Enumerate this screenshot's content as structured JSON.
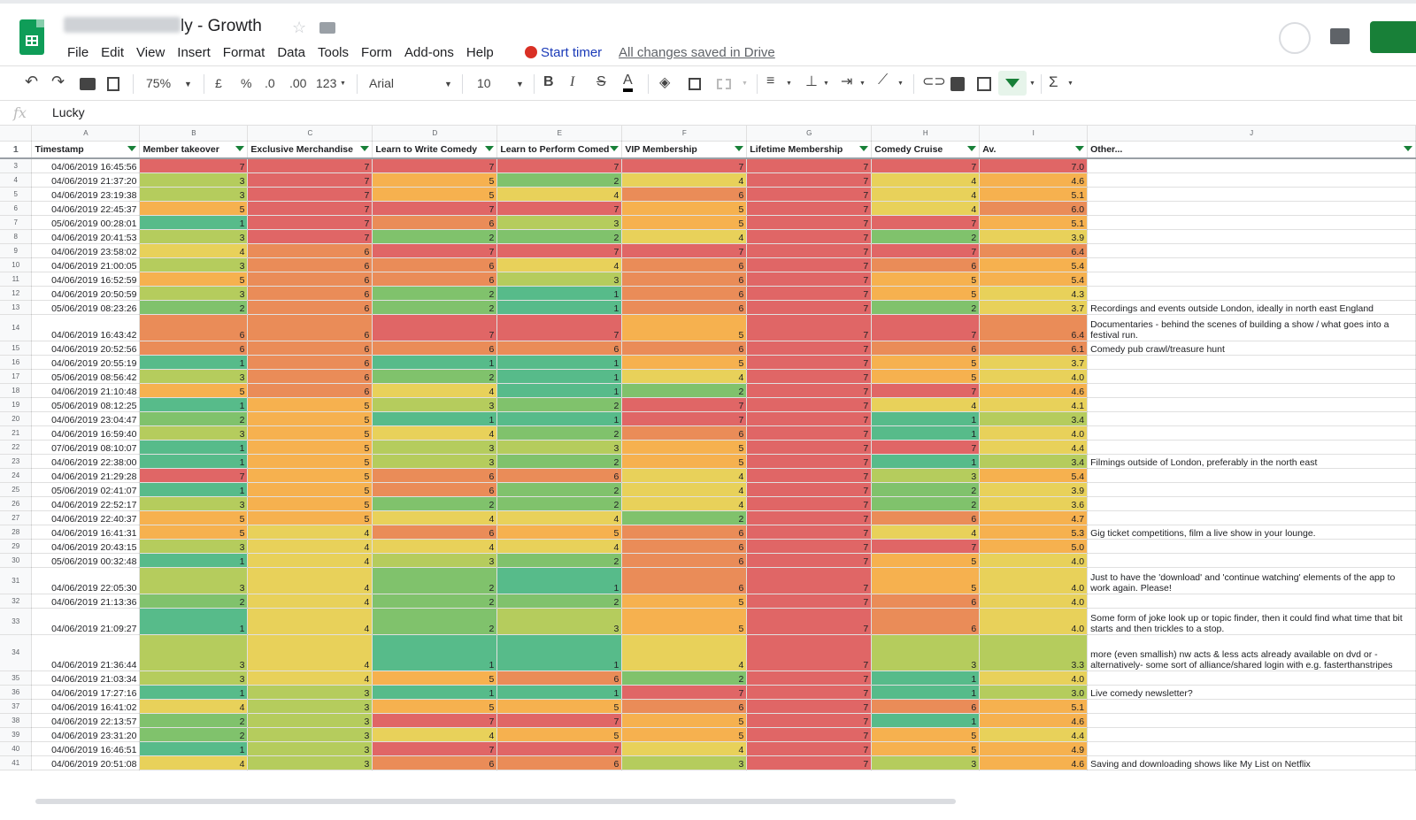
{
  "app": {
    "title_suffix": "ly - Growth",
    "menu": [
      "File",
      "Edit",
      "View",
      "Insert",
      "Format",
      "Data",
      "Tools",
      "Form",
      "Add-ons",
      "Help"
    ],
    "timer_label": "Start timer",
    "saved_label": "All changes saved in Drive"
  },
  "toolbar": {
    "zoom": "75%",
    "currency": "£",
    "percent": "%",
    "dec_decrease": ".0",
    "dec_increase": ".00",
    "format_more": "123",
    "font": "Arial",
    "font_size": "10",
    "bold": "B",
    "italic": "I",
    "strike": "S",
    "text_color": "A",
    "sum": "Σ"
  },
  "formula_bar": {
    "fx": "fx",
    "value": "Lucky"
  },
  "sheet": {
    "col_letters": [
      "A",
      "B",
      "C",
      "D",
      "E",
      "F",
      "G",
      "H",
      "I",
      "J"
    ],
    "headers": [
      "Timestamp",
      "Member takeover",
      "Exclusive Merchandise",
      "Learn to Write Comedy",
      "Learn to Perform Comed",
      "VIP Membership",
      "Lifetime Membership",
      "Comedy Cruise",
      "Av.",
      "Other..."
    ],
    "header_row_num": "1",
    "scale_colors": {
      "1": "#57bb8a",
      "2": "#80c26c",
      "3": "#b5cc5d",
      "4": "#e8d15a",
      "5": "#f6b14f",
      "6": "#ea8c58",
      "7": "#e06666"
    },
    "rows": [
      {
        "n": "3",
        "ts": "04/06/2019 16:45:56",
        "v": [
          7,
          7,
          7,
          7,
          7,
          7,
          7
        ],
        "av": "7.0",
        "other": ""
      },
      {
        "n": "4",
        "ts": "04/06/2019 21:37:20",
        "v": [
          3,
          7,
          5,
          2,
          4,
          7,
          4
        ],
        "av": "4.6",
        "other": ""
      },
      {
        "n": "5",
        "ts": "04/06/2019 23:19:38",
        "v": [
          3,
          7,
          5,
          4,
          6,
          7,
          4
        ],
        "av": "5.1",
        "other": ""
      },
      {
        "n": "6",
        "ts": "04/06/2019 22:45:37",
        "v": [
          5,
          7,
          7,
          7,
          5,
          7,
          4
        ],
        "av": "6.0",
        "other": ""
      },
      {
        "n": "7",
        "ts": "05/06/2019 00:28:01",
        "v": [
          1,
          7,
          6,
          3,
          5,
          7,
          7
        ],
        "av": "5.1",
        "other": ""
      },
      {
        "n": "8",
        "ts": "04/06/2019 20:41:53",
        "v": [
          3,
          7,
          2,
          2,
          4,
          7,
          2
        ],
        "av": "3.9",
        "other": ""
      },
      {
        "n": "9",
        "ts": "04/06/2019 23:58:02",
        "v": [
          4,
          6,
          7,
          7,
          7,
          7,
          7
        ],
        "av": "6.4",
        "other": ""
      },
      {
        "n": "10",
        "ts": "04/06/2019 21:00:05",
        "v": [
          3,
          6,
          6,
          4,
          6,
          7,
          6
        ],
        "av": "5.4",
        "other": ""
      },
      {
        "n": "11",
        "ts": "04/06/2019 16:52:59",
        "v": [
          5,
          6,
          6,
          3,
          6,
          7,
          5
        ],
        "av": "5.4",
        "other": ""
      },
      {
        "n": "12",
        "ts": "04/06/2019 20:50:59",
        "v": [
          3,
          6,
          2,
          1,
          6,
          7,
          5
        ],
        "av": "4.3",
        "other": ""
      },
      {
        "n": "13",
        "ts": "05/06/2019 08:23:26",
        "v": [
          2,
          6,
          2,
          1,
          6,
          7,
          2
        ],
        "av": "3.7",
        "other": "Recordings and events outside London, ideally in north east England"
      },
      {
        "n": "14",
        "ts": "04/06/2019 16:43:42",
        "v": [
          6,
          6,
          7,
          7,
          5,
          7,
          7
        ],
        "av": "6.4",
        "other": "Documentaries - behind the scenes of building a show / what goes into a festival run.",
        "tall": 2
      },
      {
        "n": "15",
        "ts": "04/06/2019 20:52:56",
        "v": [
          6,
          6,
          6,
          6,
          6,
          7,
          6
        ],
        "av": "6.1",
        "other": "Comedy pub crawl/treasure hunt"
      },
      {
        "n": "16",
        "ts": "04/06/2019 20:55:19",
        "v": [
          1,
          6,
          1,
          1,
          5,
          7,
          5
        ],
        "av": "3.7",
        "other": ""
      },
      {
        "n": "17",
        "ts": "05/06/2019 08:56:42",
        "v": [
          3,
          6,
          2,
          1,
          4,
          7,
          5
        ],
        "av": "4.0",
        "other": ""
      },
      {
        "n": "18",
        "ts": "04/06/2019 21:10:48",
        "v": [
          5,
          6,
          4,
          1,
          2,
          7,
          7
        ],
        "av": "4.6",
        "other": ""
      },
      {
        "n": "19",
        "ts": "05/06/2019 08:12:25",
        "v": [
          1,
          5,
          3,
          2,
          7,
          7,
          4
        ],
        "av": "4.1",
        "other": ""
      },
      {
        "n": "20",
        "ts": "04/06/2019 23:04:47",
        "v": [
          2,
          5,
          1,
          1,
          7,
          7,
          1
        ],
        "av": "3.4",
        "other": ""
      },
      {
        "n": "21",
        "ts": "04/06/2019 16:59:40",
        "v": [
          3,
          5,
          4,
          2,
          6,
          7,
          1
        ],
        "av": "4.0",
        "other": ""
      },
      {
        "n": "22",
        "ts": "07/06/2019 08:10:07",
        "v": [
          1,
          5,
          3,
          3,
          5,
          7,
          7
        ],
        "av": "4.4",
        "other": ""
      },
      {
        "n": "23",
        "ts": "04/06/2019 22:38:00",
        "v": [
          1,
          5,
          3,
          2,
          5,
          7,
          1
        ],
        "av": "3.4",
        "other": "Filmings outside of London, preferably in the north east"
      },
      {
        "n": "24",
        "ts": "04/06/2019 21:29:28",
        "v": [
          7,
          5,
          6,
          6,
          4,
          7,
          3
        ],
        "av": "5.4",
        "other": ""
      },
      {
        "n": "25",
        "ts": "05/06/2019 02:41:07",
        "v": [
          1,
          5,
          6,
          2,
          4,
          7,
          2
        ],
        "av": "3.9",
        "other": ""
      },
      {
        "n": "26",
        "ts": "04/06/2019 22:52:17",
        "v": [
          3,
          5,
          2,
          2,
          4,
          7,
          2
        ],
        "av": "3.6",
        "other": ""
      },
      {
        "n": "27",
        "ts": "04/06/2019 22:40:37",
        "v": [
          5,
          5,
          4,
          4,
          2,
          7,
          6
        ],
        "av": "4.7",
        "other": ""
      },
      {
        "n": "28",
        "ts": "04/06/2019 16:41:31",
        "v": [
          5,
          4,
          6,
          5,
          6,
          7,
          4
        ],
        "av": "5.3",
        "other": "Gig ticket competitions, film a live show in your lounge."
      },
      {
        "n": "29",
        "ts": "04/06/2019 20:43:15",
        "v": [
          3,
          4,
          4,
          4,
          6,
          7,
          7
        ],
        "av": "5.0",
        "other": ""
      },
      {
        "n": "30",
        "ts": "05/06/2019 00:32:48",
        "v": [
          1,
          4,
          3,
          2,
          6,
          7,
          5
        ],
        "av": "4.0",
        "other": ""
      },
      {
        "n": "31",
        "ts": "04/06/2019 22:05:30",
        "v": [
          3,
          4,
          2,
          1,
          6,
          7,
          5
        ],
        "av": "4.0",
        "other": "Just to have the 'download' and 'continue watching' elements of the app to work again. Please!",
        "tall": 2
      },
      {
        "n": "32",
        "ts": "04/06/2019 21:13:36",
        "v": [
          2,
          4,
          2,
          2,
          5,
          7,
          6
        ],
        "av": "4.0",
        "other": ""
      },
      {
        "n": "33",
        "ts": "04/06/2019 21:09:27",
        "v": [
          1,
          4,
          2,
          3,
          5,
          7,
          6
        ],
        "av": "4.0",
        "other": "Some form of joke look up or topic finder, then it could find what time that bit starts and then trickles to a stop.",
        "tall": 2
      },
      {
        "n": "34",
        "ts": "04/06/2019 21:36:44",
        "v": [
          3,
          4,
          1,
          1,
          4,
          7,
          3
        ],
        "av": "3.3",
        "other": "more (even smallish) nw acts & less acts already available on dvd or -alternatively- some sort of alliance/shared login with e.g. fasterthanstripes",
        "tall": 3
      },
      {
        "n": "35",
        "ts": "04/06/2019 21:03:34",
        "v": [
          3,
          4,
          5,
          6,
          2,
          7,
          1
        ],
        "av": "4.0",
        "other": ""
      },
      {
        "n": "36",
        "ts": "04/06/2019 17:27:16",
        "v": [
          1,
          3,
          1,
          1,
          7,
          7,
          1
        ],
        "av": "3.0",
        "other": "Live comedy newsletter?"
      },
      {
        "n": "37",
        "ts": "04/06/2019 16:41:02",
        "v": [
          4,
          3,
          5,
          5,
          6,
          7,
          6
        ],
        "av": "5.1",
        "other": ""
      },
      {
        "n": "38",
        "ts": "04/06/2019 22:13:57",
        "v": [
          2,
          3,
          7,
          7,
          5,
          7,
          1
        ],
        "av": "4.6",
        "other": ""
      },
      {
        "n": "39",
        "ts": "04/06/2019 23:31:20",
        "v": [
          2,
          3,
          4,
          5,
          5,
          7,
          5
        ],
        "av": "4.4",
        "other": ""
      },
      {
        "n": "40",
        "ts": "04/06/2019 16:46:51",
        "v": [
          1,
          3,
          7,
          7,
          4,
          7,
          5
        ],
        "av": "4.9",
        "other": ""
      },
      {
        "n": "41",
        "ts": "04/06/2019 20:51:08",
        "v": [
          4,
          3,
          6,
          6,
          3,
          7,
          3
        ],
        "av": "4.6",
        "other": "Saving and downloading shows like My List on Netflix"
      }
    ]
  }
}
